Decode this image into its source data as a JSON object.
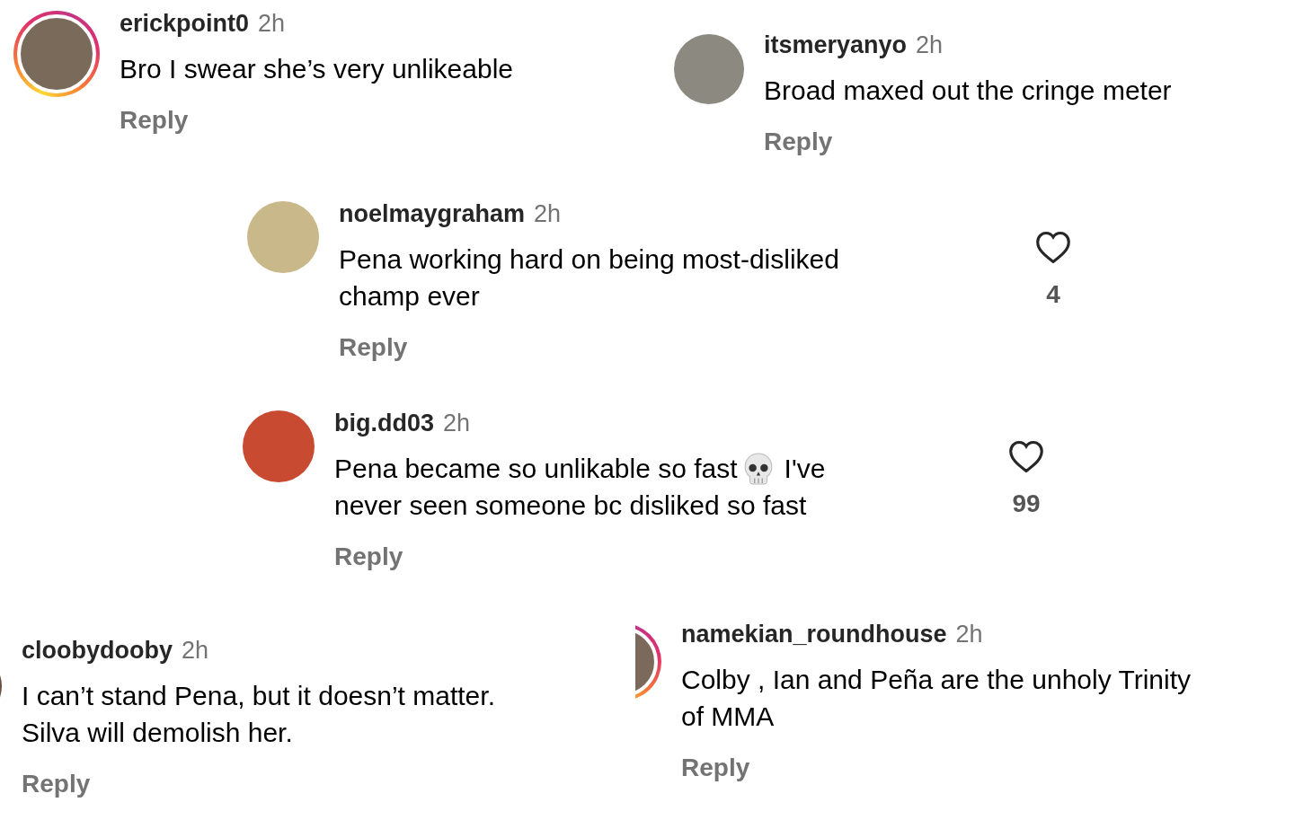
{
  "comments": [
    {
      "username": "erickpoint0",
      "time": "2h",
      "body": [
        [
          "Bro I swear she’s very unlikeable"
        ]
      ],
      "reply": "Reply",
      "story_ring": true
    },
    {
      "username": "itsmeryanyo",
      "time": "2h",
      "body": [
        [
          "Broad maxed out the cringe meter"
        ]
      ],
      "reply": "Reply",
      "story_ring": false
    },
    {
      "username": "noelmaygraham",
      "time": "2h",
      "body": [
        [
          "Pena working hard on being most-disliked"
        ],
        [
          "champ ever"
        ]
      ],
      "reply": "Reply",
      "story_ring": false,
      "likes": "4"
    },
    {
      "username": "big.dd03",
      "time": "2h",
      "body": [
        [
          "Pena became so unlikable so fast",
          "I've"
        ],
        [
          "never seen someone bc disliked so fast"
        ]
      ],
      "reply": "Reply",
      "story_ring": false,
      "likes": "99"
    },
    {
      "username": "cloobydooby",
      "time": "2h",
      "body": [
        [
          "I can’t stand Pena, but it doesn’t matter."
        ],
        [
          "Silva will demolish her."
        ]
      ],
      "reply": "Reply",
      "story_ring": false
    },
    {
      "username": "namekian_roundhouse",
      "time": "2h",
      "body": [
        [
          "Colby , Ian and Peña are the unholy Trinity"
        ],
        [
          "of MMA"
        ]
      ],
      "reply": "Reply",
      "story_ring": true
    }
  ]
}
